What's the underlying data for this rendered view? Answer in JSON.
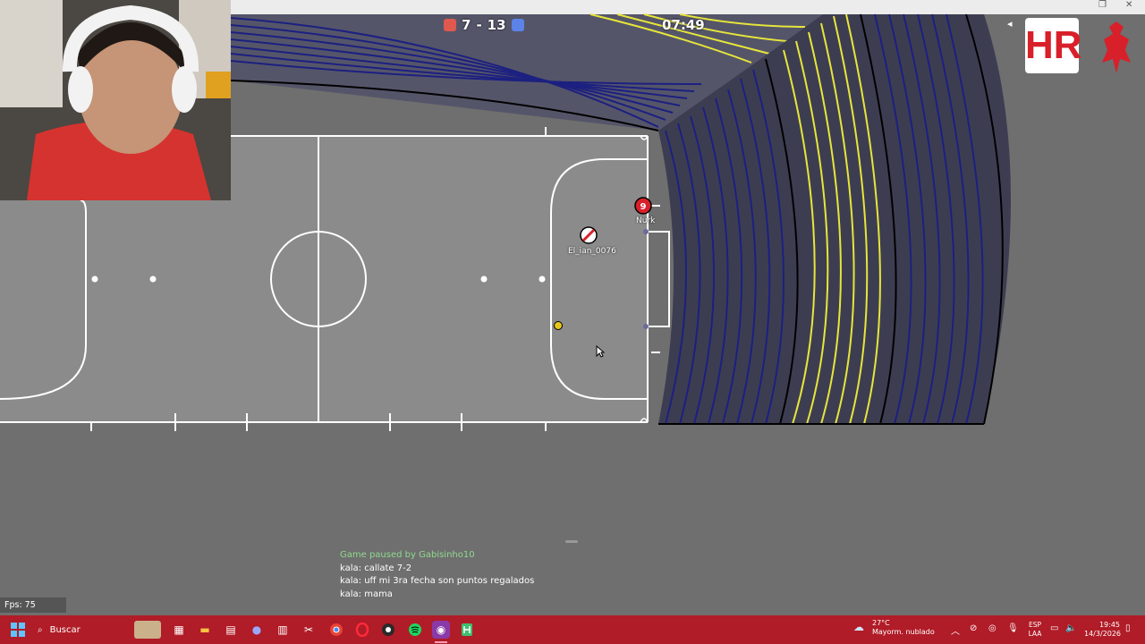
{
  "scoreboard": {
    "red_score": "7",
    "separator": "-",
    "blue_score": "13",
    "timer": "07:49",
    "red_color": "#e0594f",
    "blue_color": "#5b83e8"
  },
  "players": [
    {
      "id": "red-9",
      "number": "9",
      "name": "Nurk",
      "team": "red"
    },
    {
      "id": "el-ian",
      "number": "",
      "name": "El_ian_0076",
      "team": "red"
    }
  ],
  "ball": {
    "color": "#e8c51c"
  },
  "chat": {
    "system": "Game paused by Gabisinho10",
    "messages": [
      "kala: callate 7-2",
      "kala: uff mi 3ra fecha son puntos regalados",
      "kala: mama"
    ]
  },
  "fps": "Fps: 75",
  "taskbar": {
    "search_placeholder": "Buscar",
    "weather_temp": "27°C",
    "weather_desc": "Mayorm. nublado",
    "lang_top": "ESP",
    "lang_bottom": "LAA",
    "time": "19:45",
    "date": "14/3/2026",
    "apps": [
      "windows-icon",
      "search-icon",
      "widgets-icon",
      "store-icon",
      "files-icon",
      "calculator-icon",
      "teams-icon",
      "notepad-icon",
      "snipping-icon",
      "chrome-icon",
      "opera-icon",
      "obs-icon",
      "spotify-icon",
      "discord-icon",
      "haxball-icon"
    ]
  },
  "overlay": {
    "logo_text": "HR"
  },
  "colors": {
    "field": "#8a8a8a",
    "stand_blue": "#1c2080",
    "stand_yellow": "#e6e63a",
    "taskbar": "#b01c27"
  }
}
